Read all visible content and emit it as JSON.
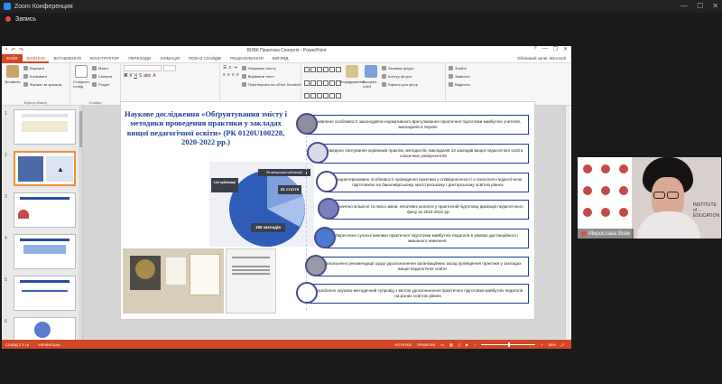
{
  "zoom": {
    "title": "Zoom Конференция",
    "recording_label": "Запись"
  },
  "ppt": {
    "window_title": "ВОВК Практика Сенергія - PowerPoint",
    "account": "Обліковий запис Microsoft",
    "tabs": [
      "ФАЙЛ",
      "ВСТАВЛЕННЯ",
      "КОНСТРУКТОР",
      "ПЕРЕХОДИ",
      "АНІМАЦІЯ",
      "ПОКАЗ СЛАЙДІВ",
      "РЕЦЕНЗУВАННЯ",
      "ВИГЛЯД"
    ],
    "active_tab": "ВІЛЕННЯ",
    "ribbon": {
      "paste": "Вставити",
      "cut": "Вирізати",
      "copy": "Копіювати",
      "format_painter": "Формат за зразком",
      "clipboard_group": "Буфер обміну",
      "new_slide": "Створити слайд",
      "layout": "Макет",
      "reset": "Скинути",
      "section": "Розділ",
      "slides_group": "Слайди",
      "font_group": "Шрифт",
      "paragraph_group": "Абзац",
      "text_direction": "Напрямок тексту",
      "align_text": "Вирівняти текст",
      "convert_smartart": "Перетворити на об'єкт SmartArt",
      "arrange": "Упорядкування",
      "quick_styles": "Експрес-стилі",
      "drawing_group": "Креслення",
      "shape_fill": "Заливка фігури",
      "shape_outline": "Контур фігури",
      "shape_effects": "Ефекти для фігур",
      "find": "Знайти",
      "replace": "Замінити",
      "select": "Виділити",
      "editing_group": "Редагування"
    },
    "thumb_numbers": [
      "1",
      "2",
      "3",
      "4",
      "5",
      "6"
    ],
    "status": {
      "slide": "СЛАЙД 2 З 16",
      "lang": "УКРАЇНСЬКА",
      "notes": "НОТАТКИ",
      "comments": "ПРИМІТКИ",
      "zoom": "85%"
    }
  },
  "slide": {
    "title": "Наукове дослідження «Обґрунтування змісту і методики проведення практики у закладах вищої педагогічної освіти» (РК 0120U100228, 2020-2022 рр.)",
    "items": [
      "Виявлено особливості законодавчо-нормативного врегулювання практичної підготовки майбутніх учителів, викладачів в Україні",
      "Проведено опитування керівників практик, методистів, викладачів 13 закладів вищої педагогічної освіти, класичних університетів",
      "Схарактеризовано особливості проведення практики у співвіднесеності з психолого-педагогічною підготовкою на бакалаврському, магістерському і докторському освітніх рівнях",
      "Означено кількісні та якісні зміни, негативні аспекти у практичній підготовці фахівців педагогічного фаху за 2016-2022 рр.",
      "Окреслено сучасні виклики практичної підготовки майбутніх педагогів в умовах дистанційного і змішаного навчання",
      "Узагальнено рекомендації щодо удосконалення організаційних засад проведення практики у закладах вищої педагогічної освіти",
      "Розроблено науково-методичний супровід з метою удосконалення практичної підготовки майбутніх педагогів на різних освітніх рівнях"
    ],
    "circle_colors": [
      "#8e8e9e",
      "#d8dcea",
      "#ffffff",
      "#7b7fc0",
      "#4a7ad0",
      "#9a9aa6",
      "#ffffff"
    ],
    "pie_labels": {
      "a": "144 публікації",
      "b": "55 авторських публікацій",
      "c": "41 стаття",
      "d": "155 закладів"
    }
  },
  "video": {
    "participant": "Мирослава Вовк",
    "institute_text": "INSTITUTE of ... EDUCATION"
  }
}
